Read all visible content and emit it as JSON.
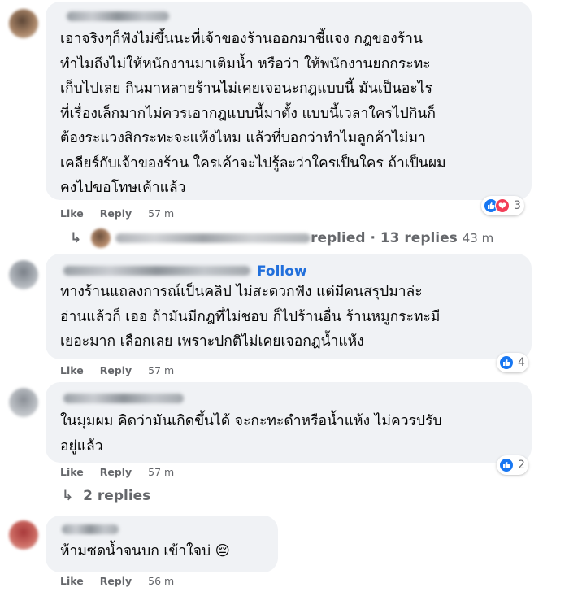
{
  "comments": [
    {
      "text": "เอาจริงๆก็ฟังไม่ขึ้นนะที่เจ้าของร้านออกมาชี้แจง กฎของร้าน\nทำไมถึงไม่ให้หนักงานมาเติมน้ำ หรือว่า ให้พนักงานยกกระทะ\nเก็บไปเลย กินมาหลายร้านไม่เคยเจอนะกฎแบบนี้ มันเป็นอะไร\nที่เรื่องเล็กมากไม่ควรเอากฎแบบนี้มาตั้ง แบบนี้เวลาใครไปกินก็\nต้องระแวงสิกระทะจะแห้งไหม แล้วที่บอกว่าทำไมลูกค้าไม่มา\nเคลียร์กับเจ้าของร้าน ใครเค้าจะไปรู้ละว่าใครเป็นใคร ถ้าเป็นผม\nคงไปขอโทษเค้าแล้ว",
      "like": "Like",
      "reply": "Reply",
      "time": "57 m",
      "reaction_count": "3",
      "reply_thread": "replied · 13 replies",
      "reply_thread_time": "43 m"
    },
    {
      "follow": "Follow",
      "text": "ทางร้านแถลงการณ์เป็นคลิป ไม่สะดวกฟัง แต่มีคนสรุปมาล่ะ\nอ่านแล้วก็ เออ ถ้ามันมีกฎที่ไม่ชอบ ก็ไปร้านอื่น ร้านหมูกระทะมี\nเยอะมาก เลือกเลย เพราะปกติไม่เคยเจอกฎน้ำแห้ง",
      "like": "Like",
      "reply": "Reply",
      "time": "57 m",
      "reaction_count": "4"
    },
    {
      "text": "ในมุมผม คิดว่ามันเกิดขึ้นได้ จะกะทะดำหรือน้ำแห้ง ไม่ควรปรับ\nอยู่แล้ว",
      "like": "Like",
      "reply": "Reply",
      "time": "57 m",
      "reaction_count": "2",
      "reply_thread": "2 replies"
    },
    {
      "text": "ห้ามซดน้ำจนบก เข้าใจบ่ 😔",
      "like": "Like",
      "reply": "Reply",
      "time": "56 m"
    }
  ],
  "icons": {
    "reply_arrow": "↳",
    "like": "thumbs-up-icon",
    "love": "heart-icon"
  },
  "colors": {
    "bubble": "#f0f2f5",
    "link": "#216fdb",
    "meta": "#65676b",
    "like_blue": "#1877f2",
    "love_red": "#f33e58"
  }
}
